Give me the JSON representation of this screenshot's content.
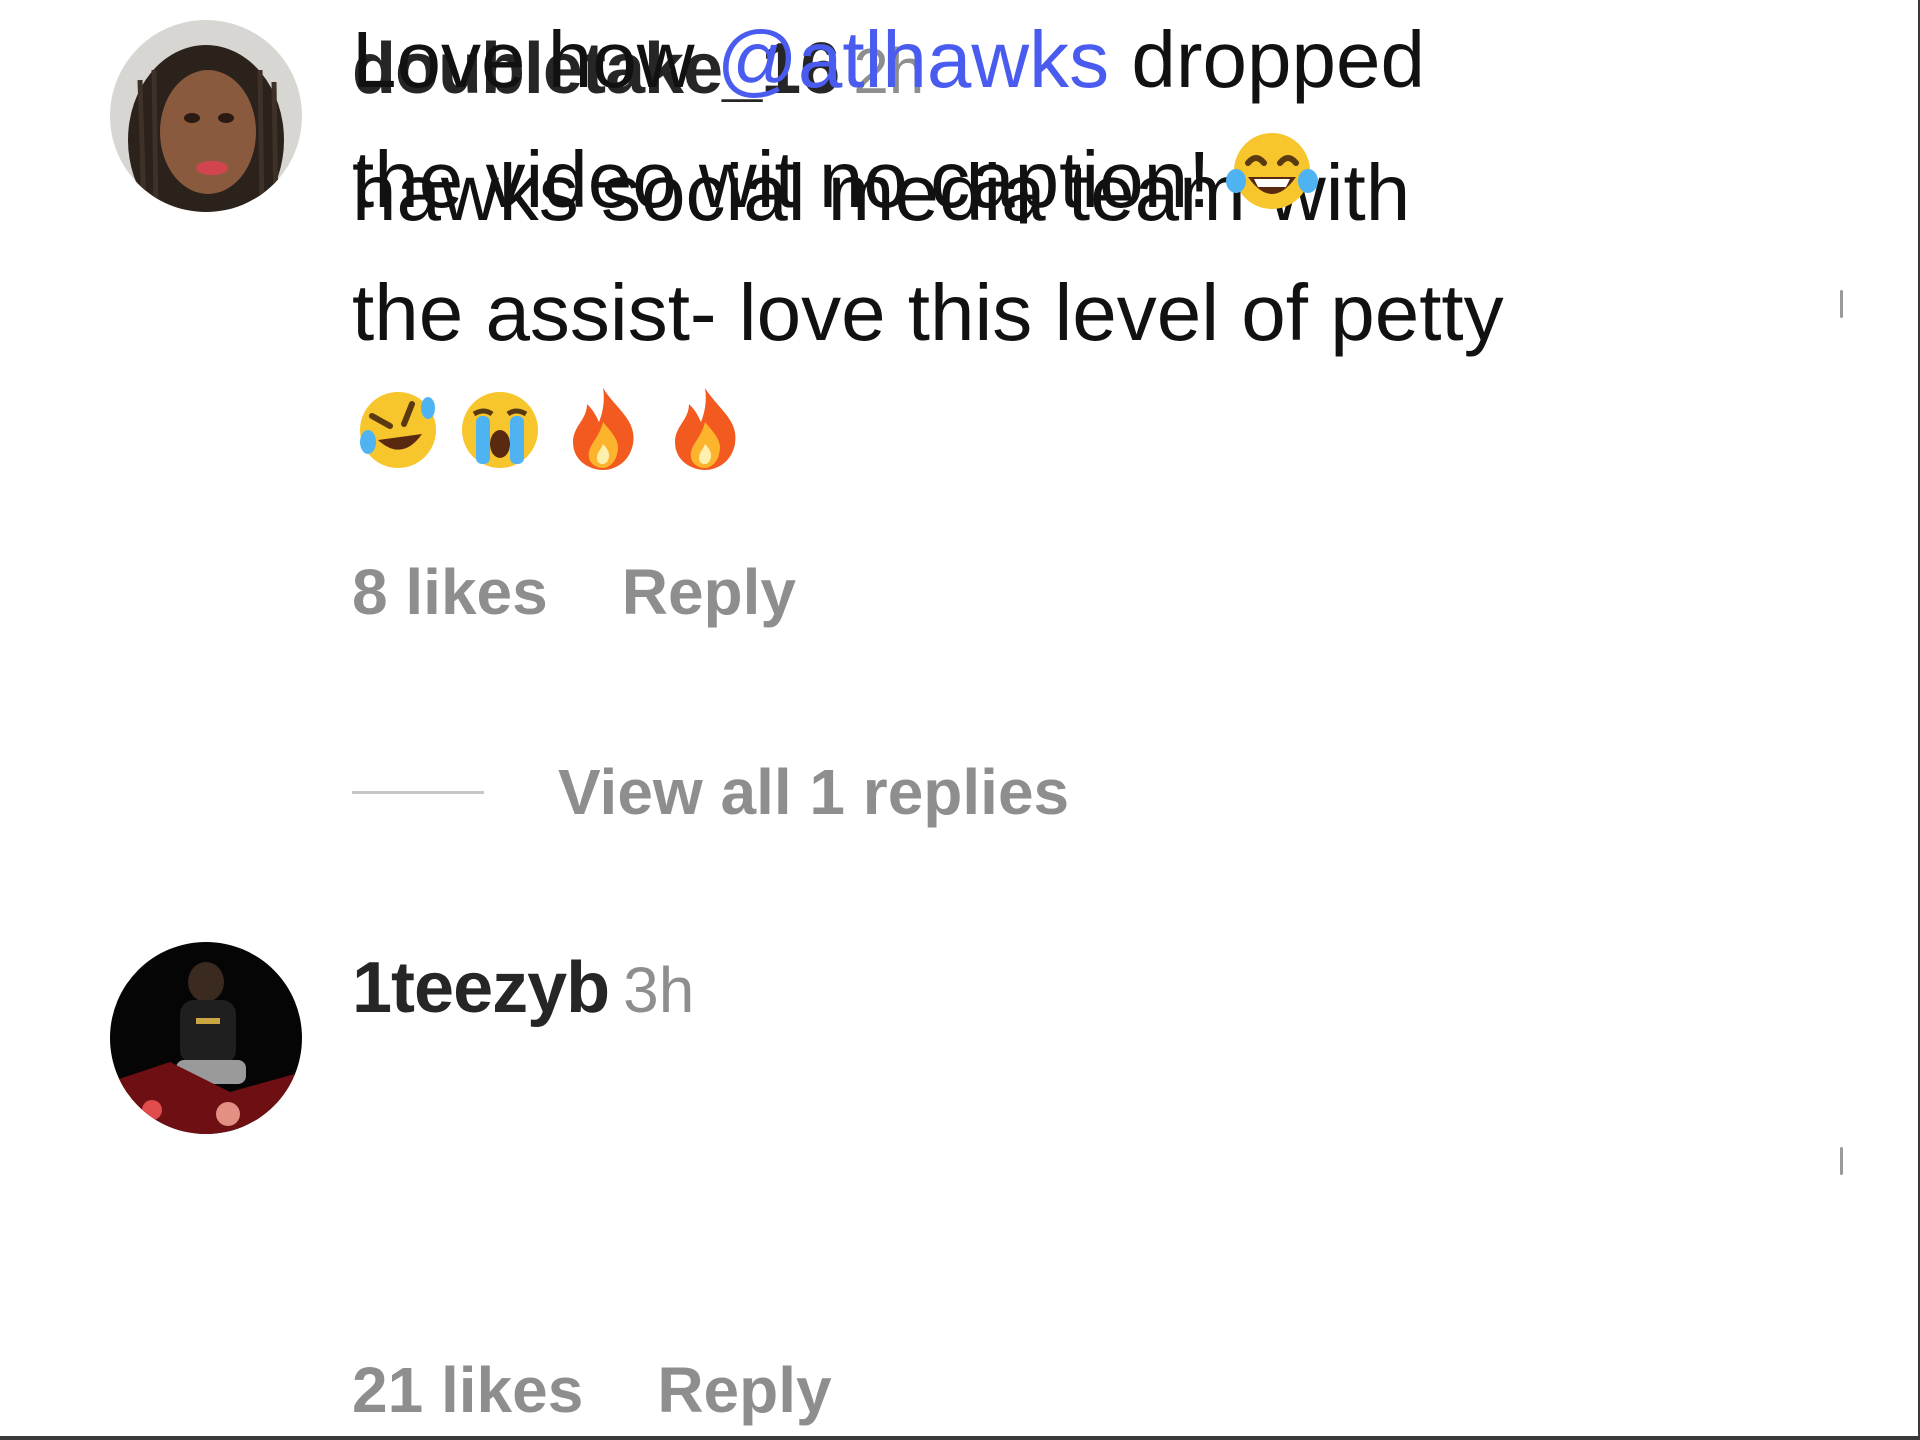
{
  "comments": [
    {
      "username": "doubletake_16",
      "time": "2h",
      "text_lines": [
        "hawks social media team with",
        "the assist- love this level of petty"
      ],
      "emojis": [
        "rolling-on-floor-laughing-emoji",
        "loudly-crying-emoji",
        "fire-emoji",
        "fire-emoji"
      ],
      "likes": "8 likes",
      "reply_label": "Reply",
      "view_replies": "View all 1 replies"
    },
    {
      "username": "1teezyb",
      "time": "3h",
      "text_line1_before": "Love how ",
      "mention": "@atlhawks",
      "text_line1_after": " dropped",
      "text_line2": "the video wit no caption!",
      "emojis": [
        "face-with-tears-of-joy-emoji"
      ],
      "likes": "21 likes",
      "reply_label": "Reply"
    }
  ],
  "colors": {
    "username": "#262626",
    "secondary": "#8e8e8e",
    "mention": "#4a5cf0",
    "body": "#111111"
  }
}
